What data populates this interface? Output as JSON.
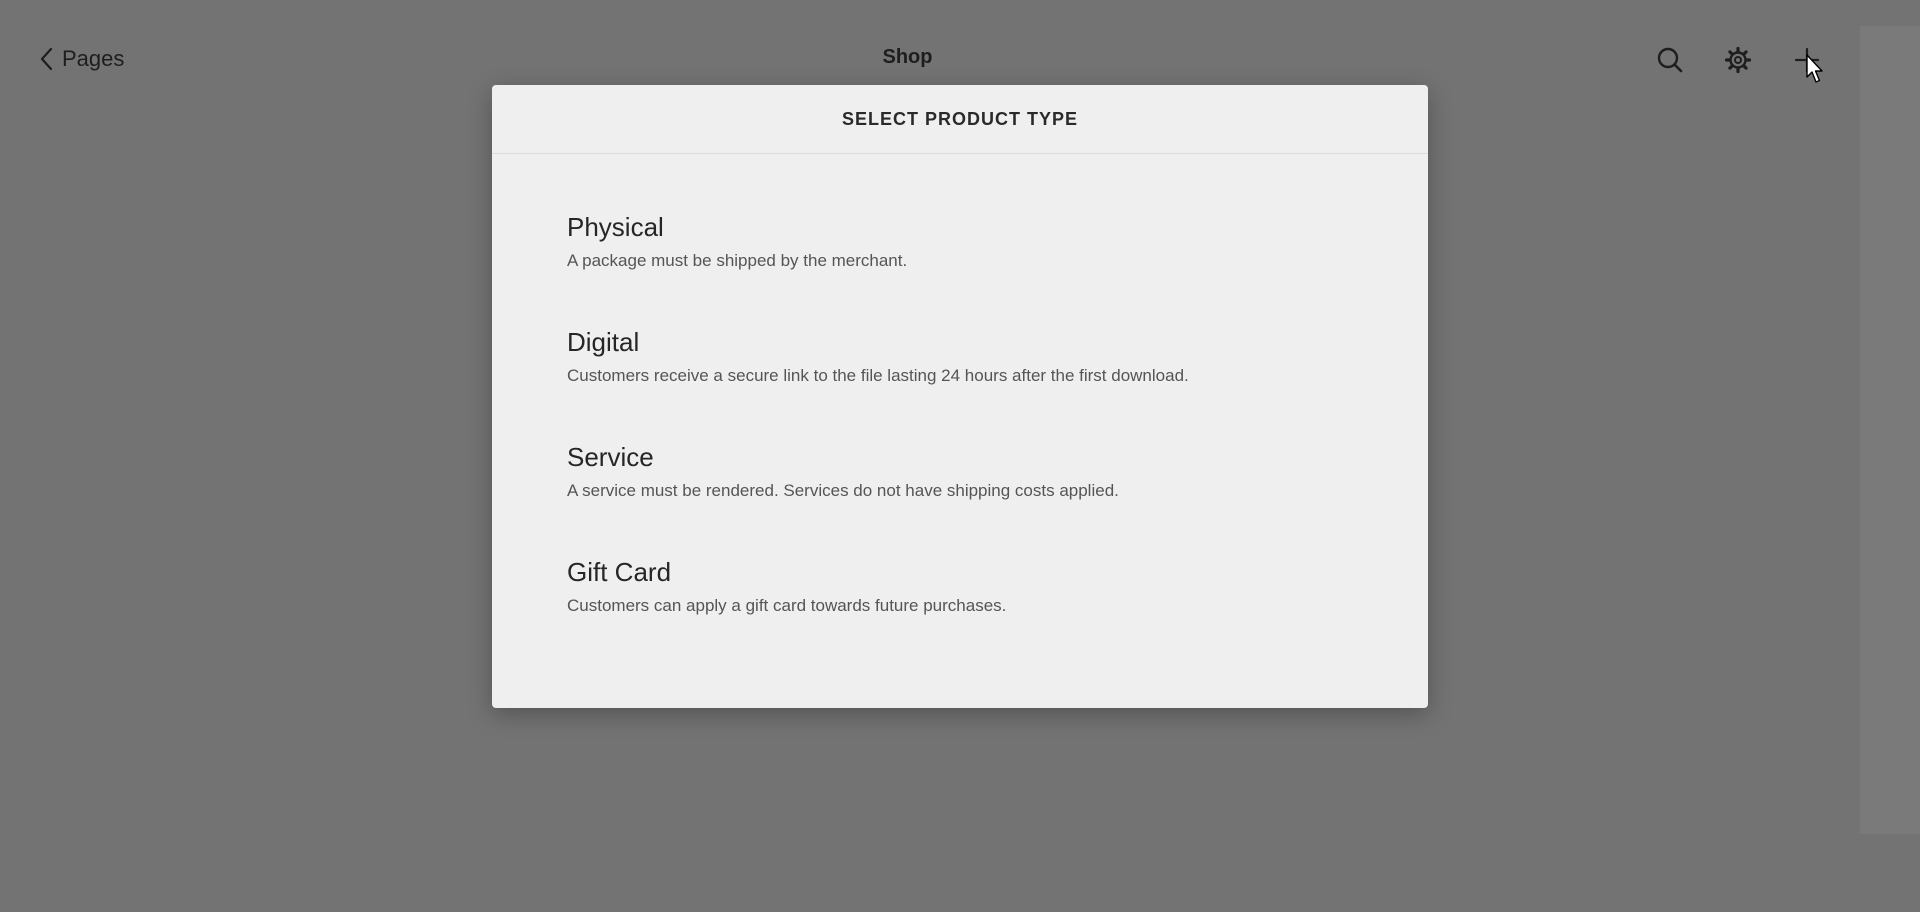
{
  "topbar": {
    "back_label": "Pages",
    "title": "Shop"
  },
  "modal": {
    "title": "SELECT PRODUCT TYPE",
    "options": [
      {
        "title": "Physical",
        "description": "A package must be shipped by the merchant."
      },
      {
        "title": "Digital",
        "description": "Customers receive a secure link to the file lasting 24 hours after the first download."
      },
      {
        "title": "Service",
        "description": "A service must be rendered. Services do not have shipping costs applied."
      },
      {
        "title": "Gift Card",
        "description": "Customers can apply a gift card towards future purchases."
      }
    ]
  },
  "icons": {
    "back": "chevron-left-icon",
    "search": "search-icon",
    "settings": "gear-icon",
    "add": "plus-icon"
  },
  "colors": {
    "overlay_background": "#737373",
    "modal_background": "#efefef",
    "text_primary": "#262626",
    "text_secondary": "#555555"
  }
}
